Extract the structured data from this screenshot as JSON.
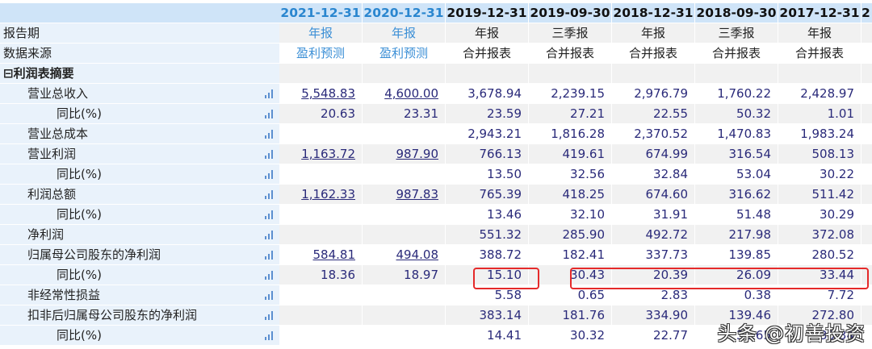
{
  "header": {
    "dates": [
      "2021-12-31",
      "2020-12-31",
      "2019-12-31",
      "2019-09-30",
      "2018-12-31",
      "2018-09-30",
      "2017-12-31",
      "2"
    ]
  },
  "rows": [
    {
      "label": "报告期",
      "indent": 0,
      "kind": "meta",
      "cells": [
        "年报",
        "年报",
        "年报",
        "三季报",
        "年报",
        "三季报",
        "年报",
        ""
      ]
    },
    {
      "label": "数据来源",
      "indent": 0,
      "kind": "meta",
      "cells": [
        "盈利预测",
        "盈利预测",
        "合并报表",
        "合并报表",
        "合并报表",
        "合并报表",
        "合并报表",
        ""
      ]
    },
    {
      "label": "利润表摘要",
      "indent": 0,
      "kind": "section",
      "cells": [
        "",
        "",
        "",
        "",
        "",
        "",
        "",
        ""
      ]
    },
    {
      "label": "营业总收入",
      "indent": 1,
      "link": true,
      "cells": [
        "5,548.83",
        "4,600.00",
        "3,678.94",
        "2,239.15",
        "2,976.79",
        "1,760.22",
        "2,428.97",
        ""
      ]
    },
    {
      "label": "同比(%)",
      "indent": 2,
      "cells": [
        "20.63",
        "23.31",
        "23.59",
        "27.21",
        "22.55",
        "50.32",
        "1.01",
        ""
      ]
    },
    {
      "label": "营业总成本",
      "indent": 1,
      "cells": [
        "",
        "",
        "2,943.21",
        "1,816.28",
        "2,370.52",
        "1,470.83",
        "1,983.24",
        ""
      ]
    },
    {
      "label": "营业利润",
      "indent": 1,
      "link": true,
      "cells": [
        "1,163.72",
        "987.90",
        "766.13",
        "419.61",
        "674.99",
        "316.54",
        "508.13",
        ""
      ]
    },
    {
      "label": "同比(%)",
      "indent": 2,
      "cells": [
        "",
        "",
        "13.50",
        "32.56",
        "32.84",
        "53.04",
        "30.22",
        ""
      ]
    },
    {
      "label": "利润总额",
      "indent": 1,
      "link": true,
      "cells": [
        "1,162.33",
        "987.83",
        "765.39",
        "418.25",
        "674.60",
        "316.62",
        "511.42",
        ""
      ]
    },
    {
      "label": "同比(%)",
      "indent": 2,
      "cells": [
        "",
        "",
        "13.46",
        "32.10",
        "31.91",
        "51.48",
        "30.29",
        ""
      ]
    },
    {
      "label": "净利润",
      "indent": 1,
      "cells": [
        "",
        "",
        "551.32",
        "285.90",
        "492.72",
        "217.98",
        "372.08",
        ""
      ]
    },
    {
      "label": "归属母公司股东的净利润",
      "indent": 1,
      "link": true,
      "cells": [
        "584.81",
        "494.08",
        "388.72",
        "182.41",
        "337.73",
        "139.85",
        "280.52",
        ""
      ]
    },
    {
      "label": "同比(%)",
      "indent": 2,
      "cells": [
        "18.36",
        "18.97",
        "15.10",
        "30.43",
        "20.39",
        "26.09",
        "33.44",
        ""
      ]
    },
    {
      "label": "非经常性损益",
      "indent": 1,
      "cells": [
        "",
        "",
        "5.58",
        "0.65",
        "2.83",
        "0.38",
        "7.72",
        ""
      ]
    },
    {
      "label": "扣非后归属母公司股东的净利润",
      "indent": 1,
      "cells": [
        "",
        "",
        "383.14",
        "181.76",
        "334.90",
        "139.46",
        "272.80",
        ""
      ]
    },
    {
      "label": "同比(%)",
      "indent": 2,
      "cells": [
        "",
        "",
        "14.41",
        "30.32",
        "22.77",
        "31.65",
        "30.34",
        ""
      ]
    }
  ],
  "section_toggle": "⊟",
  "watermark": "头条 @初善投资",
  "colors": {
    "highlight": "#e52a2a",
    "header_bg": "#cfe4f8",
    "label_bg": "#e9f2fb",
    "value": "#2a2a7a",
    "forecast": "#2a86cf"
  }
}
